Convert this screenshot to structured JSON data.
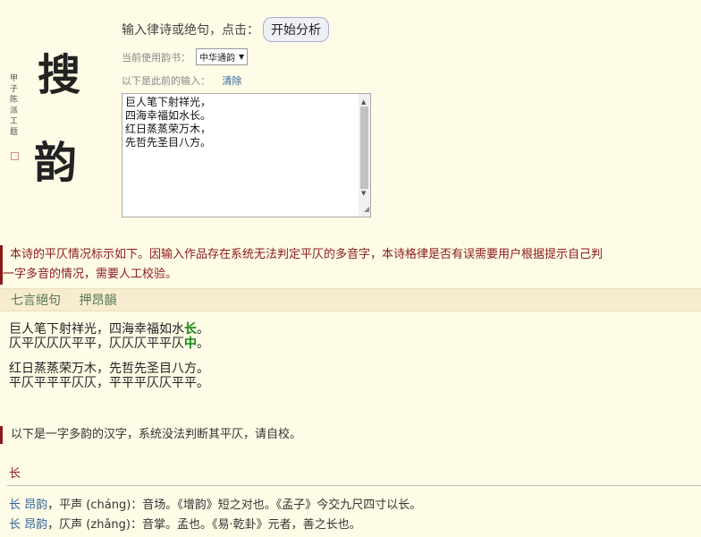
{
  "logo": {
    "char1": "搜",
    "char2": "韵",
    "side_text": "甲子陈派工题"
  },
  "form": {
    "prompt": "输入律诗或绝句，点击：",
    "button": "开始分析",
    "book_label": "当前使用韵书：",
    "book_value": "中华通韵",
    "prev_label": "以下是此前的输入：",
    "clear": "清除",
    "textarea_lines": [
      "巨人笔下射祥光，",
      "四海幸福如水长。",
      "红日蒸蒸荣万木，",
      "先哲先圣目八方。"
    ]
  },
  "notice": {
    "line1": "本诗的平仄情况标示如下。因输入作品存在系统无法判定平仄的多音字，本诗格律是否有误需要用户根据提示自己判",
    "line2": "一字多音的情况，需要人工校验。"
  },
  "form_bar": {
    "type": "七言絕句",
    "rhyme": "押昂韻"
  },
  "poem": {
    "l1a": "巨人笔下射祥光，四海幸福如水",
    "l1b": "长",
    "l1c": "。",
    "t1a": "仄平仄仄仄平平，仄仄仄平平仄",
    "t1b": "中",
    "t1c": "。",
    "l2": "红日蒸蒸荣万木，先哲先圣目八方。",
    "t2": "平仄平平平仄仄，平平平仄仄平平。"
  },
  "multi": {
    "notice": "以下是一字多韵的汉字，系统没法判断其平仄，请自校。",
    "char": "长",
    "e1_char": "长",
    "e1_rhyme": "昂韵",
    "e1_text": "，平声 (cháng)：音场。《增韵》短之对也。《孟子》今交九尺四寸以长。",
    "e2_char": "长",
    "e2_rhyme": "昂韵",
    "e2_text": "，仄声 (zhǎng)：音掌。孟也。《易·乾卦》元者，善之长也。"
  }
}
